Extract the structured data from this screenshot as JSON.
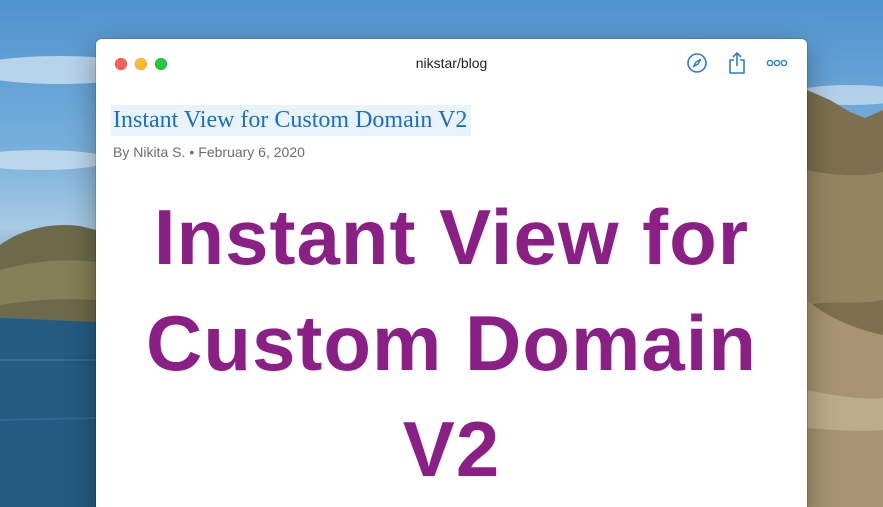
{
  "window": {
    "title": "nikstar/blog"
  },
  "toolbar": {
    "icons": [
      "compass-icon",
      "share-icon",
      "more-icon"
    ]
  },
  "article": {
    "title": "Instant View for Custom Domain V2",
    "author": "By Nikita S.",
    "separator": "•",
    "date": "February 6, 2020",
    "hero_lines": [
      "Instant View for",
      "Custom Domain",
      "V2"
    ]
  },
  "colors": {
    "link": "#1a6fc2",
    "title_highlight": "#e8f3fb",
    "hero": "#8a1f85",
    "byline": "#6d6d72",
    "toolbar_icon": "#2a7fd4"
  }
}
